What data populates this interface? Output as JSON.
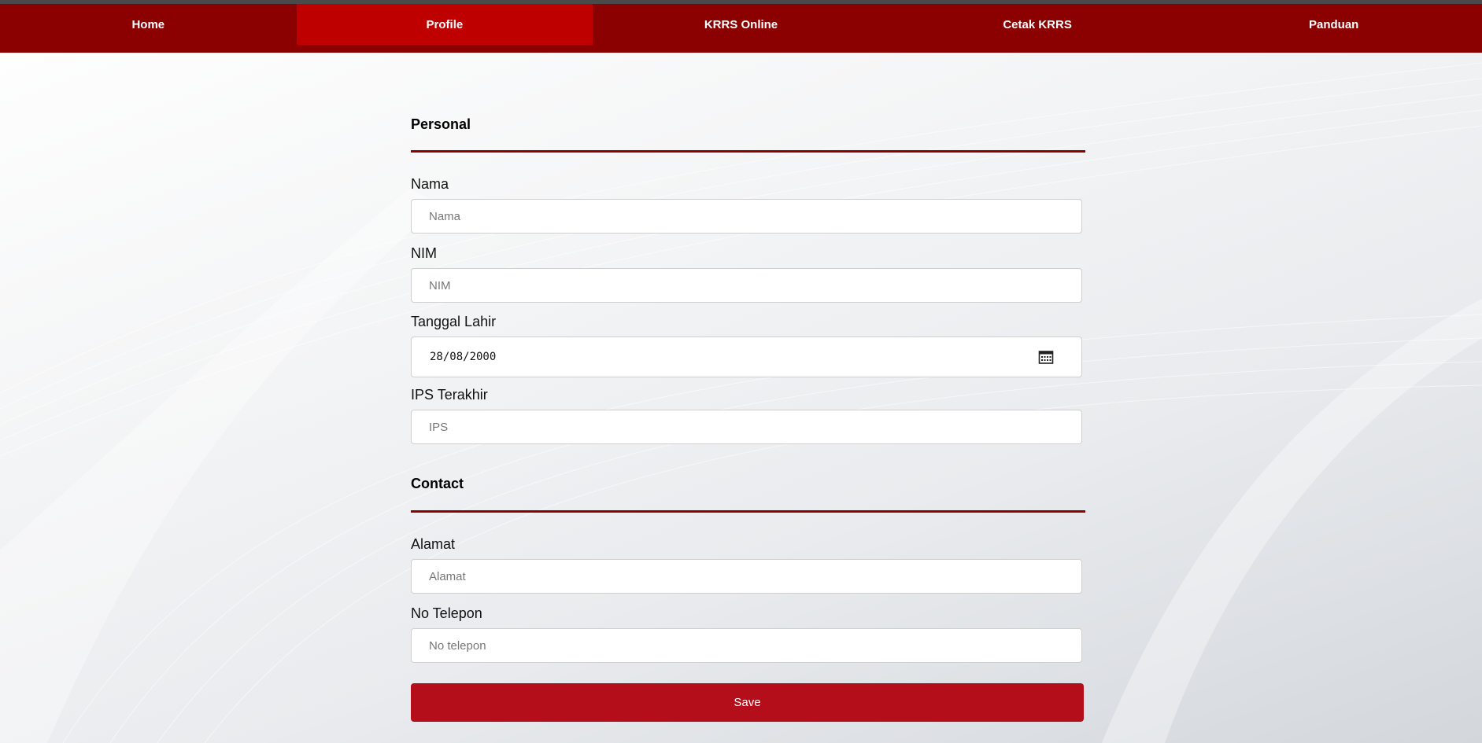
{
  "nav": {
    "items": [
      {
        "label": "Home"
      },
      {
        "label": "Profile"
      },
      {
        "label": "KRRS Online"
      },
      {
        "label": "Cetak KRRS"
      },
      {
        "label": "Panduan"
      }
    ],
    "active": "Profile"
  },
  "form": {
    "personal": {
      "title": "Personal",
      "nama": {
        "label": "Nama",
        "placeholder": "Nama",
        "value": ""
      },
      "nim": {
        "label": "NIM",
        "placeholder": "NIM",
        "value": ""
      },
      "tanggal_lahir": {
        "label": "Tanggal Lahir",
        "value": "28/08/2000",
        "icon": "calendar-icon"
      },
      "ips": {
        "label": "IPS Terakhir",
        "placeholder": "IPS",
        "value": ""
      }
    },
    "contact": {
      "title": "Contact",
      "alamat": {
        "label": "Alamat",
        "placeholder": "Alamat",
        "value": ""
      },
      "telepon": {
        "label": "No Telepon",
        "placeholder": "No telepon",
        "value": ""
      }
    },
    "save_label": "Save"
  },
  "colors": {
    "nav_bg": "#8b0000",
    "nav_active": "#bf0000",
    "accent_rule": "#8b0000",
    "save_button": "#b30e1a"
  }
}
